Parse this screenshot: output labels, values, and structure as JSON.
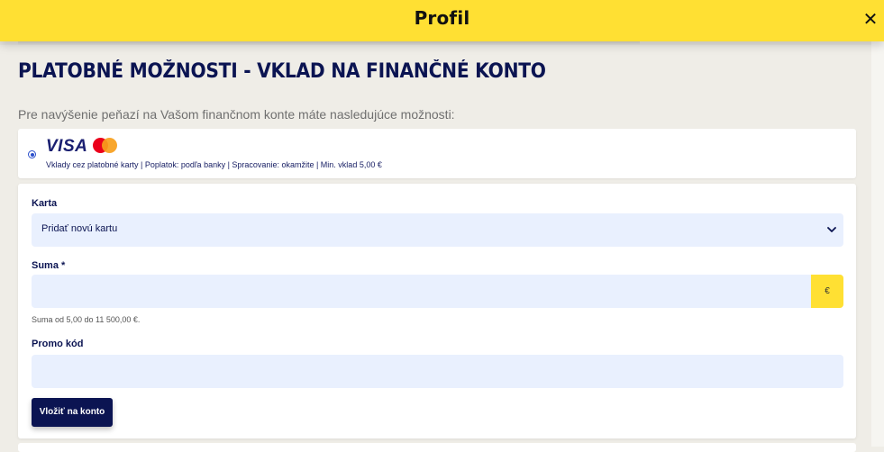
{
  "header": {
    "title": "Profil",
    "close_icon_glyph": "✕"
  },
  "page": {
    "heading": "PLATOBNÉ MOŽNOSTI - VKLAD NA FINANČNÉ KONTO",
    "intro": "Pre navýšenie peňazí na Vašom finančnom konte máte nasledujúce možnosti:"
  },
  "payment_method": {
    "selected": true,
    "brand_visa": "VISA",
    "brand_mastercard_icon": "mastercard-icon",
    "description": "Vklady cez platobné karty | Poplatok: podľa banky | Spracovanie: okamžite | Min. vklad 5,00 €"
  },
  "form": {
    "card_label": "Karta",
    "card_selected": "Pridať novú kartu",
    "amount_label": "Suma *",
    "amount_value": "",
    "currency": "€",
    "amount_hint": "Suma od 5,00 do 11 500,00 €.",
    "promo_label": "Promo kód",
    "promo_value": "",
    "submit_label": "Vložiť na konto"
  },
  "colors": {
    "accent_yellow": "#ffe033",
    "navy": "#0b1452",
    "field_bg": "#e9f0fe",
    "page_bg": "#efede7"
  }
}
